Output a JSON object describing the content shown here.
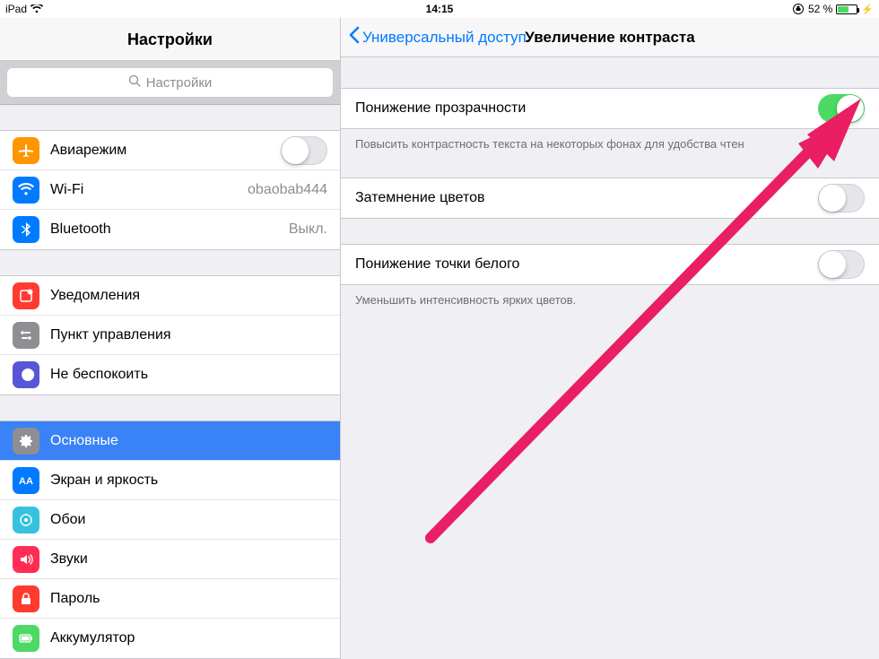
{
  "statusbar": {
    "device": "iPad",
    "time": "14:15",
    "battery_text": "52 %",
    "battery_fill_pct": 52
  },
  "sidebar": {
    "title": "Настройки",
    "search_placeholder": "Настройки",
    "groups": [
      {
        "items": [
          {
            "key": "airplane",
            "label": "Авиарежим",
            "toggle": false
          },
          {
            "key": "wifi",
            "label": "Wi-Fi",
            "value": "obaobab444"
          },
          {
            "key": "bluetooth",
            "label": "Bluetooth",
            "value": "Выкл."
          }
        ]
      },
      {
        "items": [
          {
            "key": "notifications",
            "label": "Уведомления"
          },
          {
            "key": "controlcenter",
            "label": "Пункт управления"
          },
          {
            "key": "dnd",
            "label": "Не беспокоить"
          }
        ]
      },
      {
        "items": [
          {
            "key": "general",
            "label": "Основные",
            "selected": true
          },
          {
            "key": "display",
            "label": "Экран и яркость"
          },
          {
            "key": "wallpaper",
            "label": "Обои"
          },
          {
            "key": "sounds",
            "label": "Звуки"
          },
          {
            "key": "passcode",
            "label": "Пароль"
          },
          {
            "key": "battery",
            "label": "Аккумулятор"
          }
        ]
      }
    ]
  },
  "detail": {
    "back_label": "Универсальный доступ",
    "title": "Увеличение контраста",
    "sections": [
      {
        "rows": [
          {
            "key": "reduce_transparency",
            "label": "Понижение прозрачности",
            "toggle": true
          }
        ],
        "footer": "Повысить контрастность текста на некоторых фонах для удобства чтен"
      },
      {
        "rows": [
          {
            "key": "darken_colors",
            "label": "Затемнение цветов",
            "toggle": false
          }
        ]
      },
      {
        "rows": [
          {
            "key": "reduce_white_point",
            "label": "Понижение точки белого",
            "toggle": false
          }
        ],
        "footer": "Уменьшить интенсивность ярких цветов."
      }
    ]
  },
  "icon_colors": {
    "airplane": "#ff9500",
    "wifi": "#007aff",
    "bluetooth": "#007aff",
    "notifications": "#ff3b30",
    "controlcenter": "#8e8e93",
    "dnd": "#5856d6",
    "general": "#8e8e93",
    "display": "#007aff",
    "wallpaper": "#35c2de",
    "sounds": "#ff2d55",
    "passcode": "#ff3b30",
    "battery": "#4cd964"
  }
}
